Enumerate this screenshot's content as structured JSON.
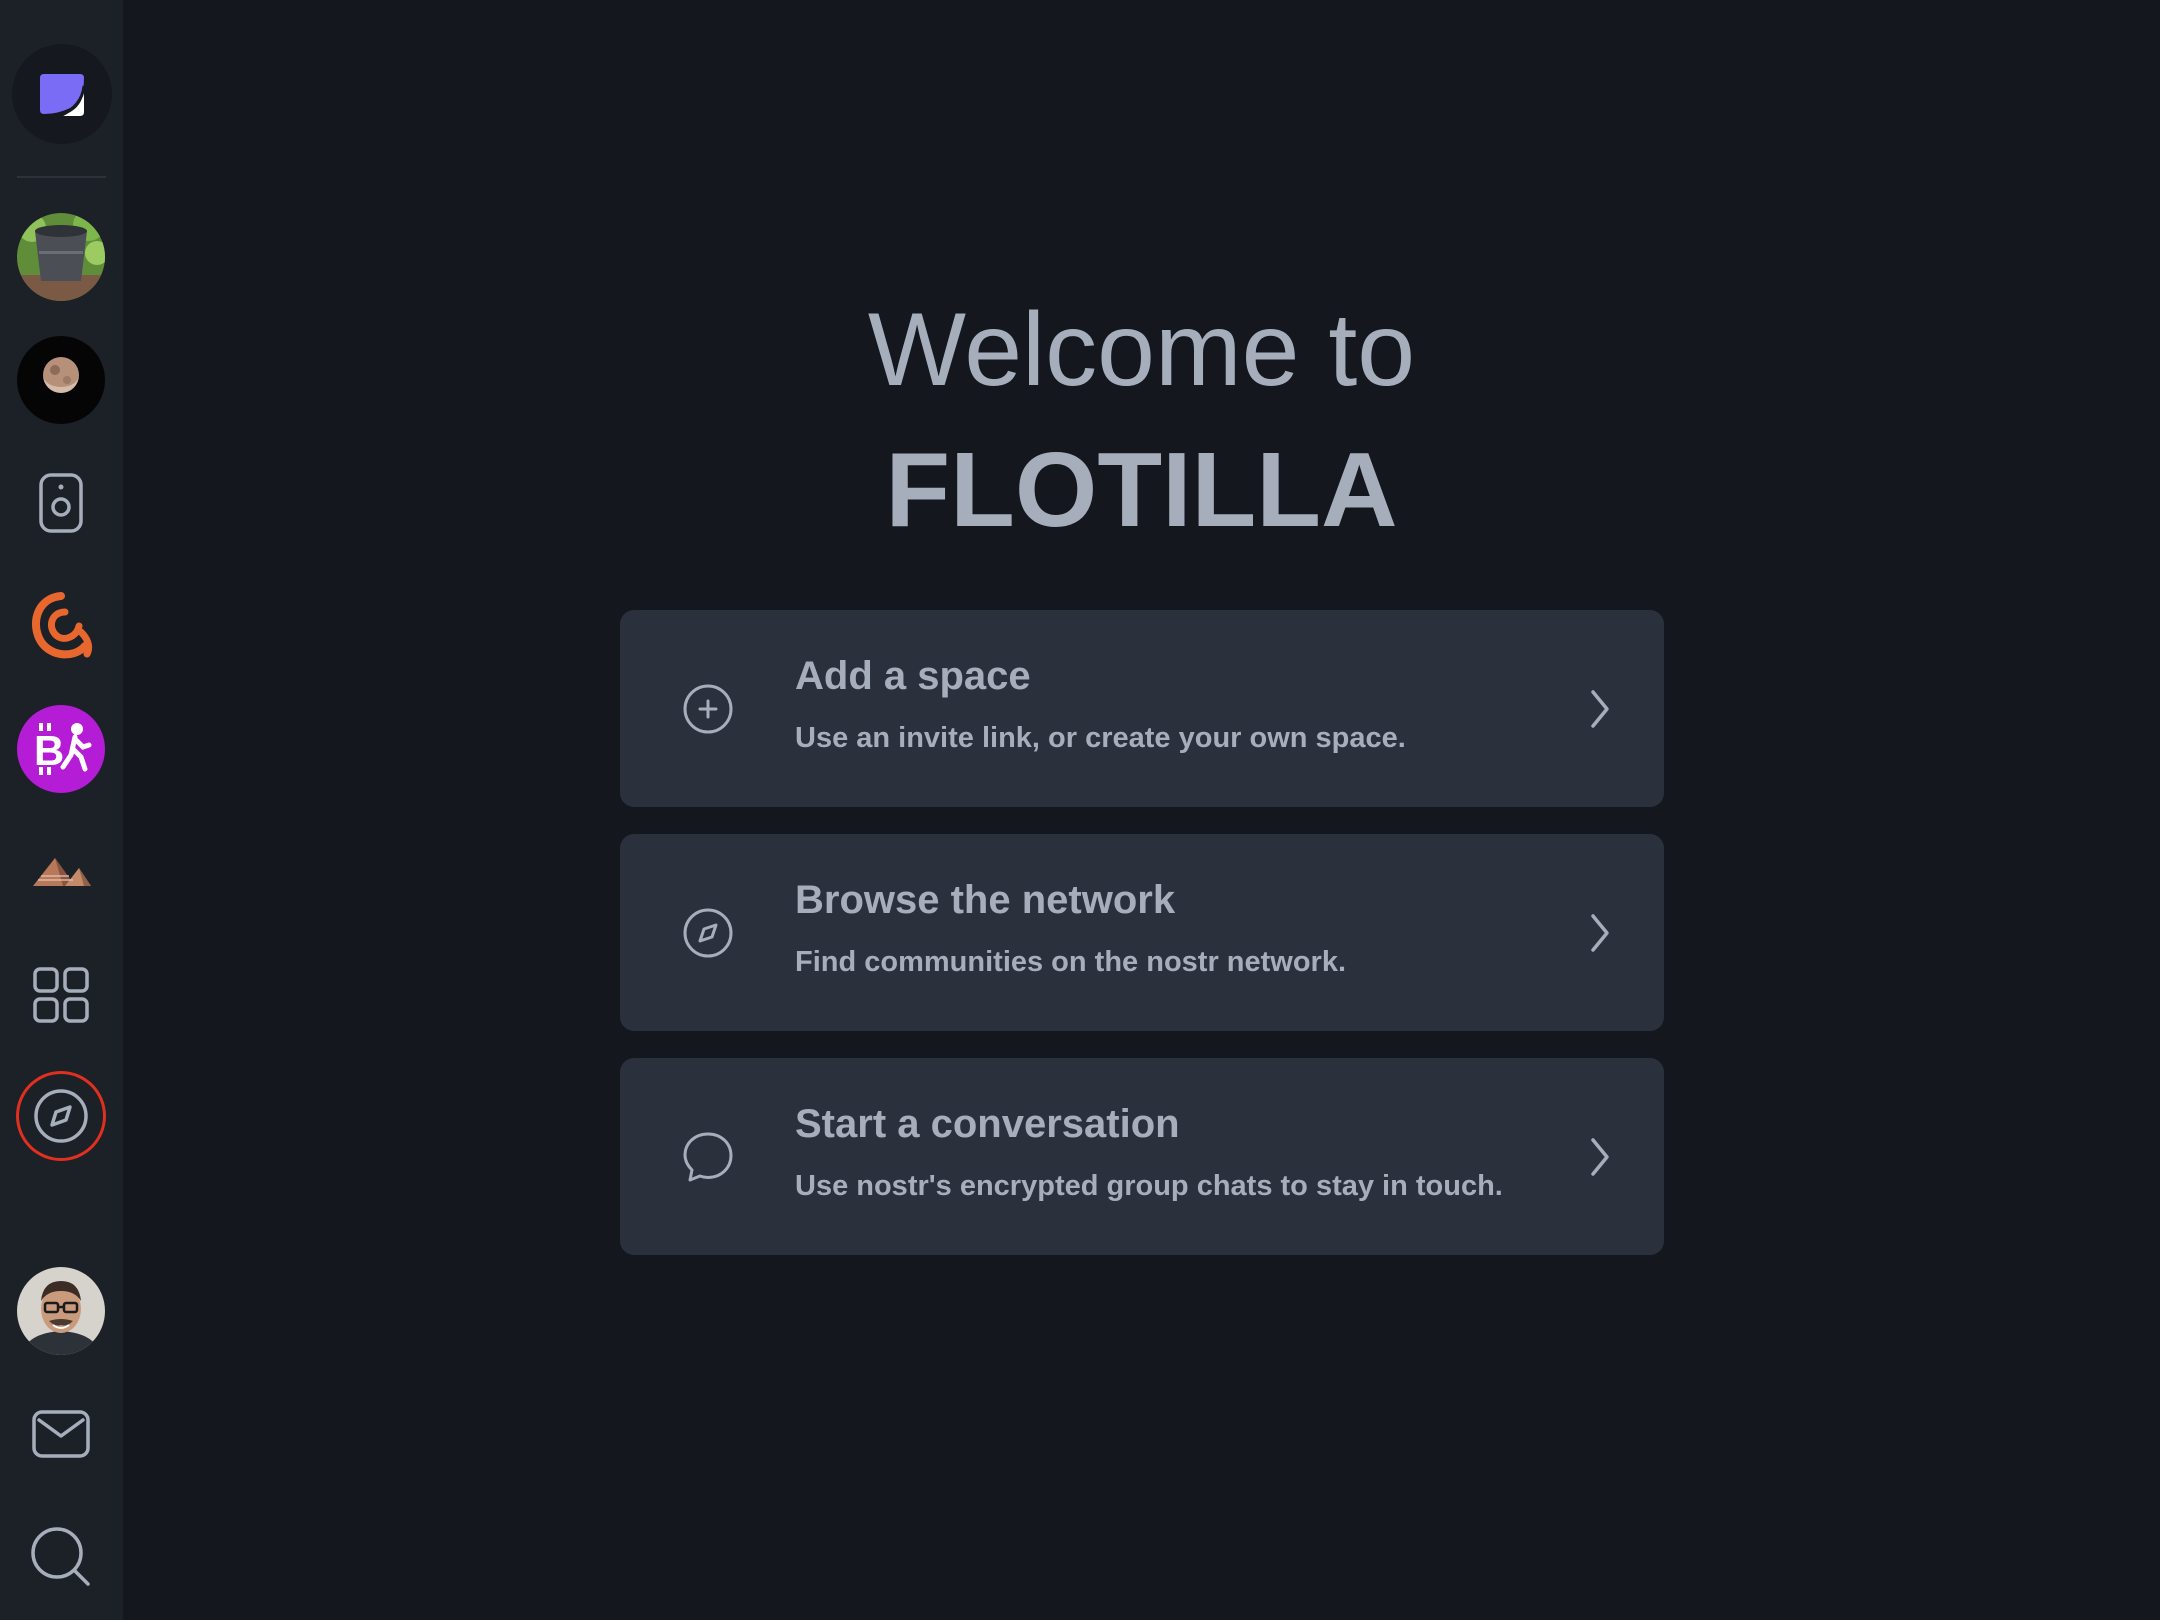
{
  "sidebar": {
    "items": [
      {
        "name": "app-logo",
        "label": ""
      },
      {
        "name": "space-bucket",
        "label": ""
      },
      {
        "name": "space-moon",
        "label": ""
      },
      {
        "name": "space-speaker",
        "label": ""
      },
      {
        "name": "space-orange-swirl",
        "label": ""
      },
      {
        "name": "space-bitcoin-walk",
        "label": ""
      },
      {
        "name": "space-pyramids",
        "label": ""
      },
      {
        "name": "spaces-grid-icon",
        "label": ""
      },
      {
        "name": "discover-icon",
        "label": ""
      },
      {
        "name": "profile-avatar",
        "label": ""
      },
      {
        "name": "messages-icon",
        "label": ""
      },
      {
        "name": "search-icon",
        "label": ""
      }
    ],
    "accent": "#7a6cf5",
    "selected_ring_color": "#e0301f"
  },
  "welcome": {
    "line1": "Welcome to",
    "line2": "FLOTILLA"
  },
  "cards": [
    {
      "icon": "plus-circle-icon",
      "title": "Add a space",
      "description": "Use an invite link, or create your own space."
    },
    {
      "icon": "compass-icon",
      "title": "Browse the network",
      "description": "Find communities on the nostr network."
    },
    {
      "icon": "chat-bubble-icon",
      "title": "Start a conversation",
      "description": "Use nostr's encrypted group chats to stay in touch."
    }
  ],
  "colors": {
    "background": "#14171d",
    "sidebar": "#1c2027",
    "card": "#2a303c",
    "text": "#a6adbb"
  }
}
